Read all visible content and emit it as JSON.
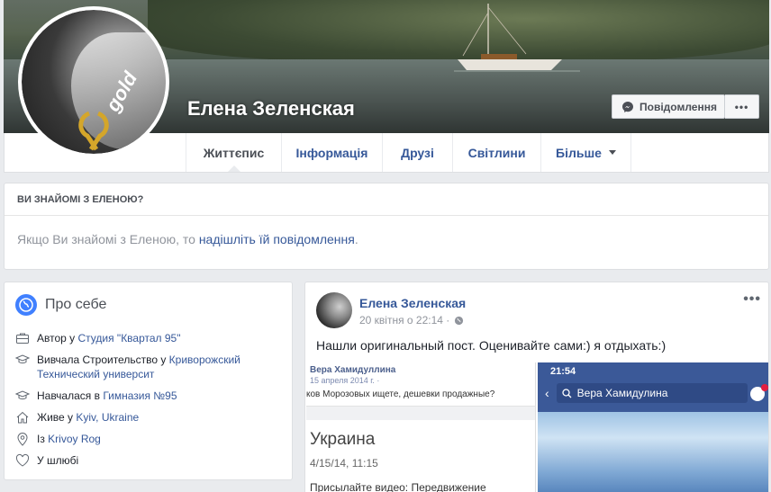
{
  "profile": {
    "name": "Елена Зеленская",
    "avatar_text": "gold",
    "message_button": "Повідомлення",
    "more_button": "•••"
  },
  "nav": {
    "tabs": [
      {
        "label": "Життєпис"
      },
      {
        "label": "Інформація"
      },
      {
        "label": "Друзі"
      },
      {
        "label": "Світлини"
      },
      {
        "label": "Більше"
      }
    ]
  },
  "know": {
    "heading": "ВИ ЗНАЙОМІ З ЕЛЕНОЮ?",
    "text_before": "Якщо Ви знайомі з Еленою, то ",
    "link": "надішліть їй повідомлення",
    "text_after": "."
  },
  "intro": {
    "title": "Про себе",
    "items": [
      {
        "icon": "briefcase-icon",
        "prefix": "Автор у ",
        "link": "Студия \"Квартал 95\""
      },
      {
        "icon": "graduation-cap-icon",
        "prefix": "Вивчала Строительство у ",
        "link": "Криворожский Технический университ"
      },
      {
        "icon": "graduation-cap-icon",
        "prefix": "Навчалася в ",
        "link": "Гимназия №95"
      },
      {
        "icon": "home-icon",
        "prefix": "Живе у ",
        "link": "Kyiv, Ukraine"
      },
      {
        "icon": "location-pin-icon",
        "prefix": "Із ",
        "link": "Krivoy Rog"
      },
      {
        "icon": "heart-icon",
        "prefix": "",
        "link": "",
        "text": "У шлюбі"
      }
    ]
  },
  "post": {
    "author": "Елена Зеленская",
    "date": "20 квітня о 22:14 ·",
    "more": "•••",
    "text": "Нашли оригинальный пост. Оценивайте сами:) я отдыхать:)",
    "screenshot1": {
      "name": "Вера Хамидуллина",
      "date": "15 апреля 2014 г. · ",
      "question": "ков Морозовых ищете, дешевки продажные?",
      "country": "Украина",
      "timestamp": "4/15/14, 11:15",
      "caption": "Присылайте видео: Передвижение"
    },
    "screenshot2": {
      "time": "21:54",
      "search": "Вера Хамидулина"
    }
  },
  "colors": {
    "link": "#365899",
    "background": "#e9ebee",
    "facebook_blue": "#3b5998"
  }
}
